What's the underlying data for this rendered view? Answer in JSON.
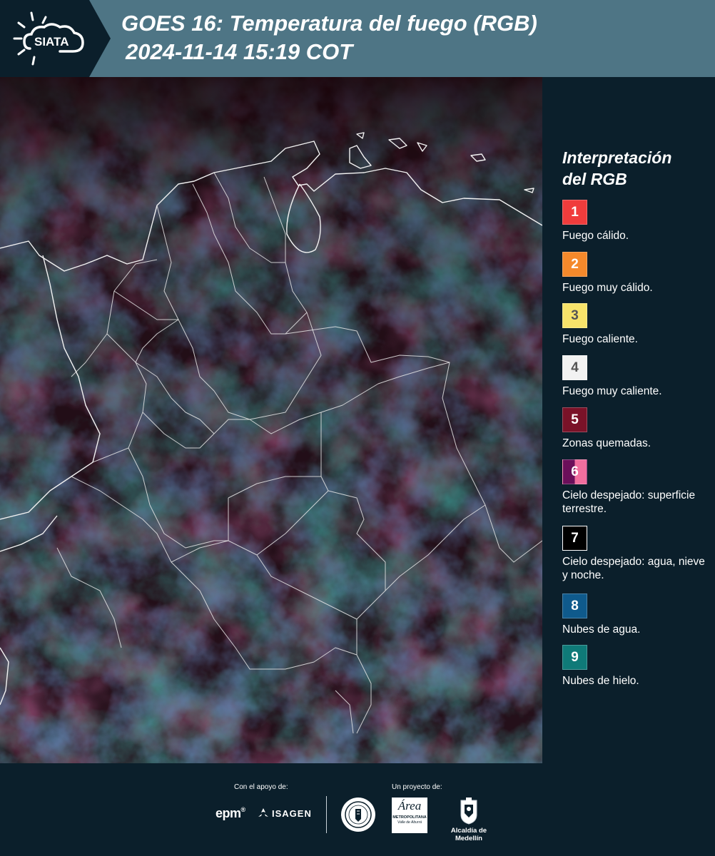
{
  "header": {
    "brand": "SIATA",
    "title": "GOES 16: Temperatura del fuego (RGB)",
    "subtitle": "2024-11-14 15:19 COT"
  },
  "legend": {
    "title_line1": "Interpretación",
    "title_line2": "del RGB",
    "items": [
      {
        "number": "1",
        "label": "Fuego cálido.",
        "color": "#f03c3c"
      },
      {
        "number": "2",
        "label": "Fuego muy cálido.",
        "color": "#f5892b"
      },
      {
        "number": "3",
        "label": "Fuego caliente.",
        "color": "#f7e36a"
      },
      {
        "number": "4",
        "label": "Fuego muy caliente.",
        "color": "#f2f2f2"
      },
      {
        "number": "5",
        "label": "Zonas quemadas.",
        "color": "#7a1228"
      },
      {
        "number": "6",
        "label": "Cielo despejado: superficie terrestre.",
        "color": "#6b0f5a",
        "color2": "#f06e9e"
      },
      {
        "number": "7",
        "label": "Cielo despejado: agua, nieve y noche.",
        "color": "#000000"
      },
      {
        "number": "8",
        "label": "Nubes de agua.",
        "color": "#0f5a8c"
      },
      {
        "number": "9",
        "label": "Nubes de hielo.",
        "color": "#0f7a78"
      }
    ]
  },
  "footer": {
    "support_label": "Con el apoyo de:",
    "project_label": "Un proyecto de:",
    "sponsor_epm": "epm",
    "sponsor_isagen": "ISAGEN",
    "sponsor_metropolitana": "METROPOLITANA",
    "sponsor_area": "Área",
    "sponsor_area_sub": "Valle de Aburrá",
    "sponsor_alcaldia": "Alcaldía de Medellín"
  },
  "colors": {
    "background": "#0b1f2b",
    "header_band": "#4e7585",
    "map_base": "#200a12"
  }
}
